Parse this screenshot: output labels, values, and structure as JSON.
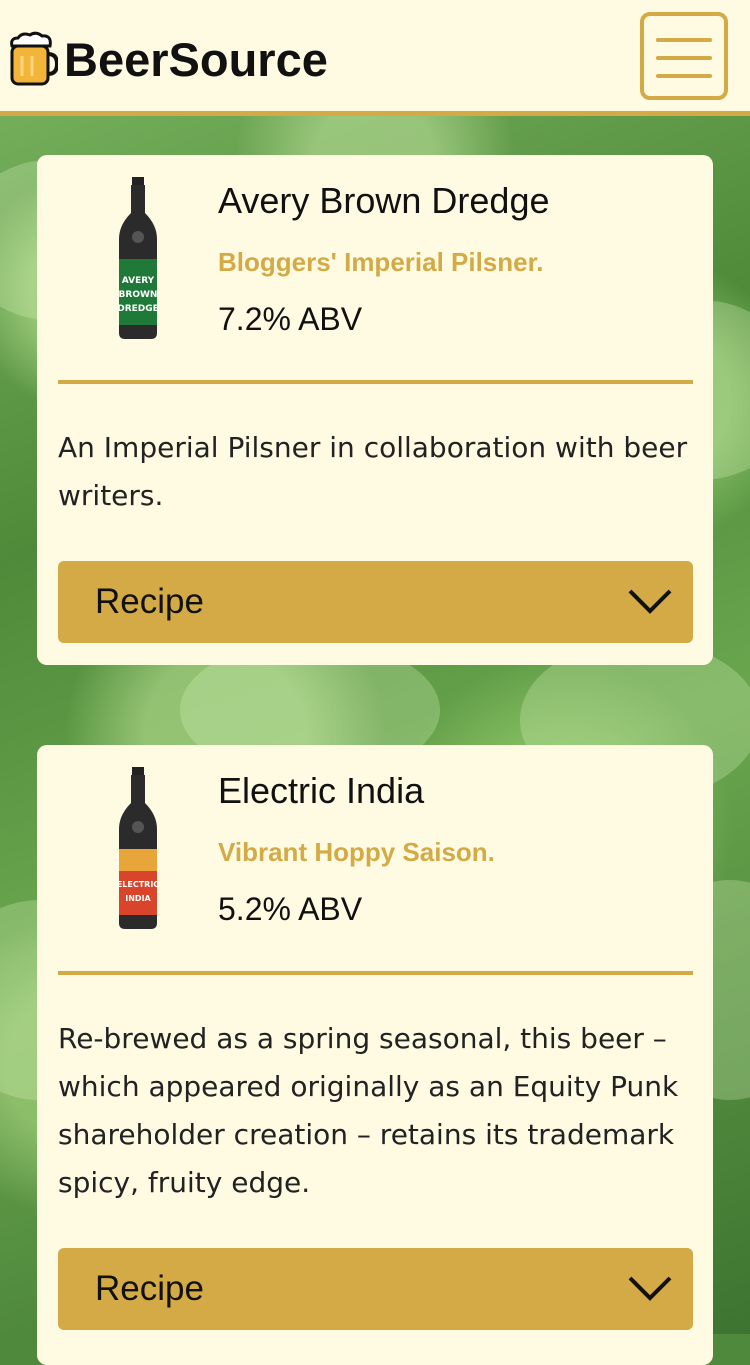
{
  "header": {
    "brand": "BeerSource",
    "logo_icon": "beer-mug-icon",
    "menu_icon": "hamburger-menu-icon"
  },
  "colors": {
    "accent": "#d3aa45",
    "card_bg": "#fffbe3",
    "text": "#111111"
  },
  "beers": [
    {
      "name": "Avery Brown Dredge",
      "tagline": "Bloggers' Imperial Pilsner.",
      "abv": "7.2% ABV",
      "description": "An Imperial Pilsner in collaboration with beer writers.",
      "recipe_label": "Recipe",
      "bottle_label_color": "#1f7a3a"
    },
    {
      "name": "Electric India",
      "tagline": "Vibrant Hoppy Saison.",
      "abv": "5.2% ABV",
      "description": "Re-brewed as a spring seasonal, this beer – which appeared originally as an Equity Punk shareholder creation – retains its trademark spicy, fruity edge.",
      "recipe_label": "Recipe",
      "bottle_label_color": "#d8452a"
    }
  ]
}
